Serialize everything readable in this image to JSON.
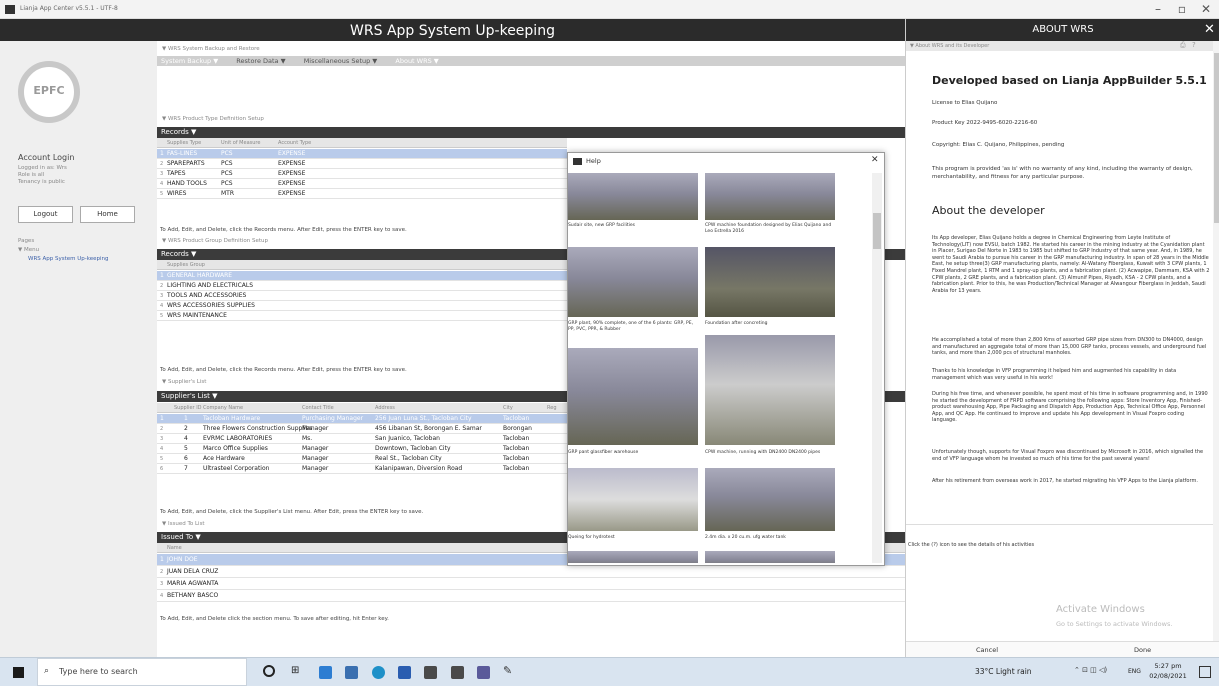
{
  "window": {
    "title": "Lianja App Center v5.5.1 - UTF-8"
  },
  "app": {
    "title": "WRS App System Up-keeping"
  },
  "sidebar": {
    "logo_text": "EPFC",
    "account_title": "Account Login",
    "account_lines": [
      "Logged in as: Wrs",
      "Role is all",
      "Tenancy is public"
    ],
    "logout": "Logout",
    "home": "Home",
    "pages_label": "Pages",
    "menu_label": "▼ Menu",
    "page_item": "WRS App System Up-keeping"
  },
  "main": {
    "sec1": "▼ WRS System Backup and Restore",
    "menu": [
      "System Backup ▼",
      "Restore Data ▼",
      "Miscellaneous Setup ▼",
      "About WRS ▼"
    ],
    "sec2": "▼ WRS Product Type Definition Setup",
    "records": "Records ▼",
    "t1_cols": [
      "Supplies Type",
      "Unit of Measure",
      "Account Type"
    ],
    "t1_rows": [
      [
        "1",
        "FAS-LINES",
        "PCS",
        "EXPENSE"
      ],
      [
        "2",
        "SPAREPARTS",
        "PCS",
        "EXPENSE"
      ],
      [
        "3",
        "TAPES",
        "PCS",
        "EXPENSE"
      ],
      [
        "4",
        "HAND TOOLS",
        "PCS",
        "EXPENSE"
      ],
      [
        "5",
        "WIRES",
        "MTR",
        "EXPENSE"
      ]
    ],
    "t1_note": "To Add, Edit, and Delete, click the Records menu. After Edit, press the ENTER key to save.",
    "sec3": "▼ WRS Product Group Definition Setup",
    "t2_cols": [
      "Supplies Group"
    ],
    "t2_rows": [
      [
        "1",
        "GENERAL HARDWARE"
      ],
      [
        "2",
        "LIGHTING AND ELECTRICALS"
      ],
      [
        "3",
        "TOOLS AND ACCESSORIES"
      ],
      [
        "4",
        "WRS ACCESSORIES SUPPLIES"
      ],
      [
        "5",
        "WRS MAINTENANCE"
      ]
    ],
    "t2_note": "To Add, Edit, and Delete, click the Records menu. After Edit, press the ENTER key to save.",
    "sec4": "▼ Supplier's List",
    "suppliers": "Supplier's List ▼",
    "t3_cols": [
      "Supplier ID",
      "Company Name",
      "Contact Title",
      "Address",
      "City",
      "Reg"
    ],
    "t3_rows": [
      [
        "1",
        "1",
        "Tacloban Hardware",
        "Purchasing Manager",
        "256 Juan Luna St., Tacloban City",
        "Tacloban"
      ],
      [
        "2",
        "2",
        "Three Flowers Construction Supplies",
        "Manager",
        "456 Libanan St, Borongan E. Samar",
        "Borongan"
      ],
      [
        "3",
        "4",
        "EVRMC LABORATORIES",
        "Ms.",
        "San Juanico, Tacloban",
        "Tacloban"
      ],
      [
        "4",
        "5",
        "Marco Office Supplies",
        "Manager",
        "Downtown, Tacloban City",
        "Tacloban"
      ],
      [
        "5",
        "6",
        "Ace Hardware",
        "Manager",
        "Real St., Tacloban City",
        "Tacloban"
      ],
      [
        "6",
        "7",
        "Ultrasteel Corporation",
        "Manager",
        "Kalanipawan, Diversion Road",
        "Tacloban"
      ]
    ],
    "t3_note": "To Add, Edit, and Delete, click the Supplier's List menu. After Edit, press the ENTER key to save.",
    "sec5": "▼ Issued To List",
    "issued": "Issued To ▼",
    "t4_cols": [
      "Name"
    ],
    "t4_rows": [
      [
        "1",
        "JOHN DOE"
      ],
      [
        "2",
        "JUAN DELA CRUZ"
      ],
      [
        "3",
        "MARIA AGWANTA"
      ],
      [
        "4",
        "BETHANY BASCO"
      ]
    ],
    "t4_note": "To Add, Edit, and Delete click the section menu. To save after editing, hit Enter key."
  },
  "help": {
    "title": "Help",
    "close": "✕",
    "captions": [
      "Sudair site, new GRP facilities",
      "CPW machine foundation designed by Elias Quijano and Leo Estrella 2016",
      "GRP plant, 90% complete, one of the 6 plants: GRP, PE, PP, PVC, PPR, & Rubber",
      "Foundation after concreting",
      "GRP pant glassfiber warehouse",
      "CPW machine, running with DN2400 DN2400 pipes",
      "Queing for hydrotest",
      "2.4m dia. x 20 cu.m. ufg water tank"
    ]
  },
  "about": {
    "header": "ABOUT WRS",
    "sub": "▼ About WRS and its Developer",
    "title": "Developed based on Lianja AppBuilder 5.5.1",
    "license": "License to Elias Quijano",
    "key": "Product Key 2022-9495-6020-2216-60",
    "copyright": "Copyright: Elias C. Quijano, Philippines, pending",
    "disclaimer": "This program is provided 'as is' with no warranty of any kind, including the warranty of design, merchantability, and fitness for any particular purpose.",
    "dev_title": "About the developer",
    "p1": "Its App developer, Elias Quijano holds a degree in Chemical Engineering from Leyte Institute of Technology(LIT) now EVSU, batch 1982. He started his career in the mining industry at the Cyanidation plant in Placer, Surigao Del Norte in 1983 to 1985 but shifted to GRP Industry of that same year. And, in 1989, he went to Saudi Arabia to pursue his career in the GRP manufacturing industry. In span of 28 years in the Middle East, he setup three(3) GRP manufacturing plants, namely: Al-Watany Fiberglass, Kuwait with 3 CPW plants, 1 Fixed Mandrel plant, 1 RTM and 1 spray-up plants, and a fabrication plant. (2) Acwapipe, Dammam, KSA with 2 CPW plants, 2 GRE plants, and a fabrication plant. (3) Almunif Pipes, Riyadh, KSA - 2 CPW plants, and a fabrication plant. Prior to this, he was Production/Technical Manager at Alwangour Fiberglass in Jeddah, Saudi Arabia for 13 years.",
    "p2": "He accomplished a total of more than 2,800 Kms of assorted GRP pipe sizes from DN300 to DN4000, design and manufactured an aggregate total of more than 15,000 GRP tanks, process vessels, and underground fuel tanks, and more than 2,000 pcs of structural manholes.",
    "p3": "Thanks to his knowledge in VFP programming it helped him and augmented his capability in data management which was very useful in his work!",
    "p4": "During his free time, and whenever possible, he spent most of his time in software programming and, in 1990 he started the development of FRPD software comprising the following apps: Store Inventory App, Finished-product warehousing App, Pipe Packaging and Dispatch App, Production App, Technical Office App, Personnel App, and QC App. He continued to improve and update his App development in Visual Foxpro coding language.",
    "p5": "Unfortunately though, supports for Visual Foxpro was discontinued by Microsoft in 2016, which signalled the end of VFP language whom he invested so much of his time for the past several years!",
    "p6": "After his retirement from overseas work in 2017, he started migrating his VFP Apps to the Lianja platform.",
    "click_note": "Click the (?) icon to see the details of his activities",
    "activate1": "Activate Windows",
    "activate2": "Go to Settings to activate Windows.",
    "cancel": "Cancel",
    "done": "Done"
  },
  "taskbar": {
    "search": "Type here to search",
    "weather": "33°C  Light rain",
    "lang": "ENG",
    "time": "5:27 pm",
    "date": "02/08/2021"
  }
}
